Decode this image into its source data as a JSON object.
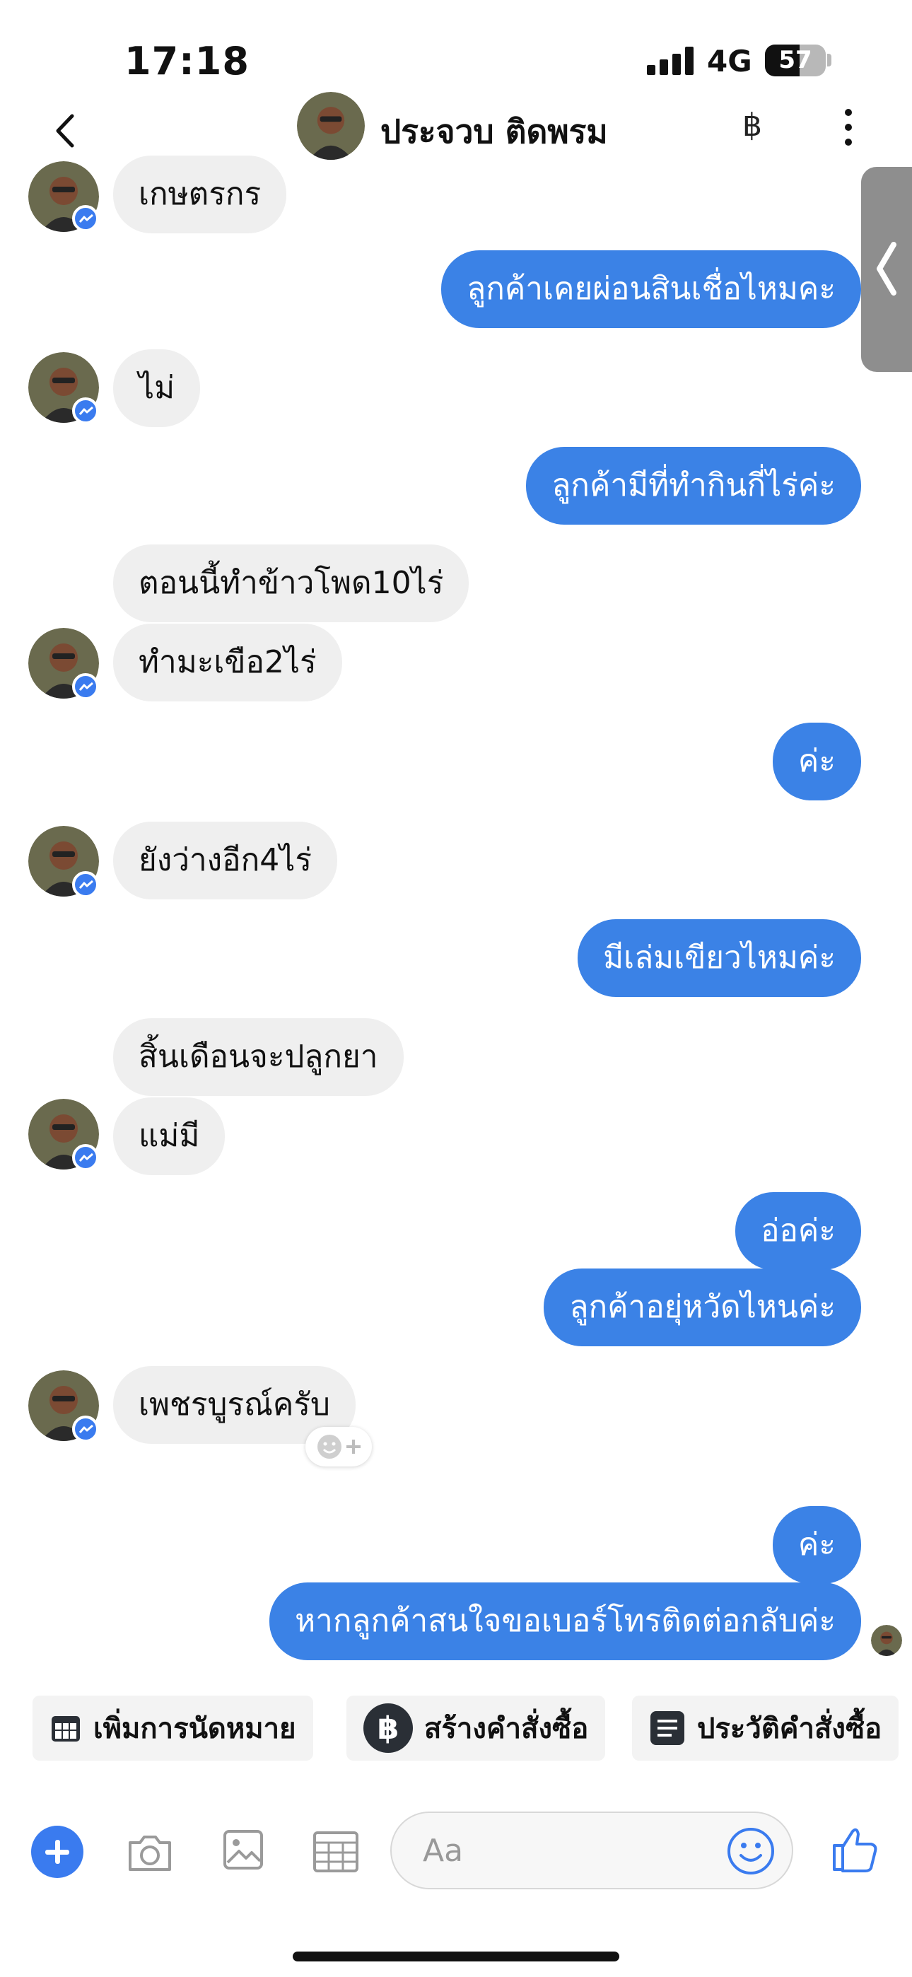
{
  "status_bar": {
    "time": "17:18",
    "network": "4G",
    "battery": "57",
    "battery_level": 0.57
  },
  "header": {
    "contact_name": "ประจวบ ติดพรม",
    "back_icon": "chevron-left-icon",
    "currency_icon": "฿",
    "menu_icon": "more-vertical-icon"
  },
  "messages": [
    {
      "side": "in",
      "text": "เกษตรกร"
    },
    {
      "side": "out",
      "text": "ลูกค้าเคยผ่อนสินเชื่อไหมคะ"
    },
    {
      "side": "in",
      "text": "ไม่"
    },
    {
      "side": "out",
      "text": "ลูกค้ามีที่ทำกินกี่ไร่ค่ะ"
    },
    {
      "side": "in",
      "text": "ตอนนี้ทำข้าวโพด10ไร่"
    },
    {
      "side": "in",
      "text": "ทำมะเขือ2ไร่"
    },
    {
      "side": "out",
      "text": "ค่ะ"
    },
    {
      "side": "in",
      "text": "ยังว่างอีก4ไร่"
    },
    {
      "side": "out",
      "text": "มีเล่มเขียวไหมค่ะ"
    },
    {
      "side": "in",
      "text": "สิ้นเดือนจะปลูกยา"
    },
    {
      "side": "in",
      "text": "แม่มี"
    },
    {
      "side": "out",
      "text": "อ่อค่ะ"
    },
    {
      "side": "out",
      "text": "ลูกค้าอยุ่หวัดไหนค่ะ"
    },
    {
      "side": "in",
      "text": "เพชรบูรณ์ครับ"
    },
    {
      "side": "out",
      "text": "ค่ะ"
    },
    {
      "side": "out",
      "text": "หากลูกค้าสนใจขอเบอร์โทรติดต่อกลับค่ะ"
    }
  ],
  "quick_actions": [
    {
      "label": "เพิ่มการนัดหมาย",
      "icon": "calendar-icon"
    },
    {
      "label": "สร้างคำสั่งซื้อ",
      "icon": "baht-icon"
    },
    {
      "label": "ประวัติคำสั่งซื้อ",
      "icon": "list-icon"
    }
  ],
  "composer": {
    "placeholder": "Aa"
  },
  "colors": {
    "accent": "#3b82e6",
    "incoming_bubble": "#efefef"
  }
}
